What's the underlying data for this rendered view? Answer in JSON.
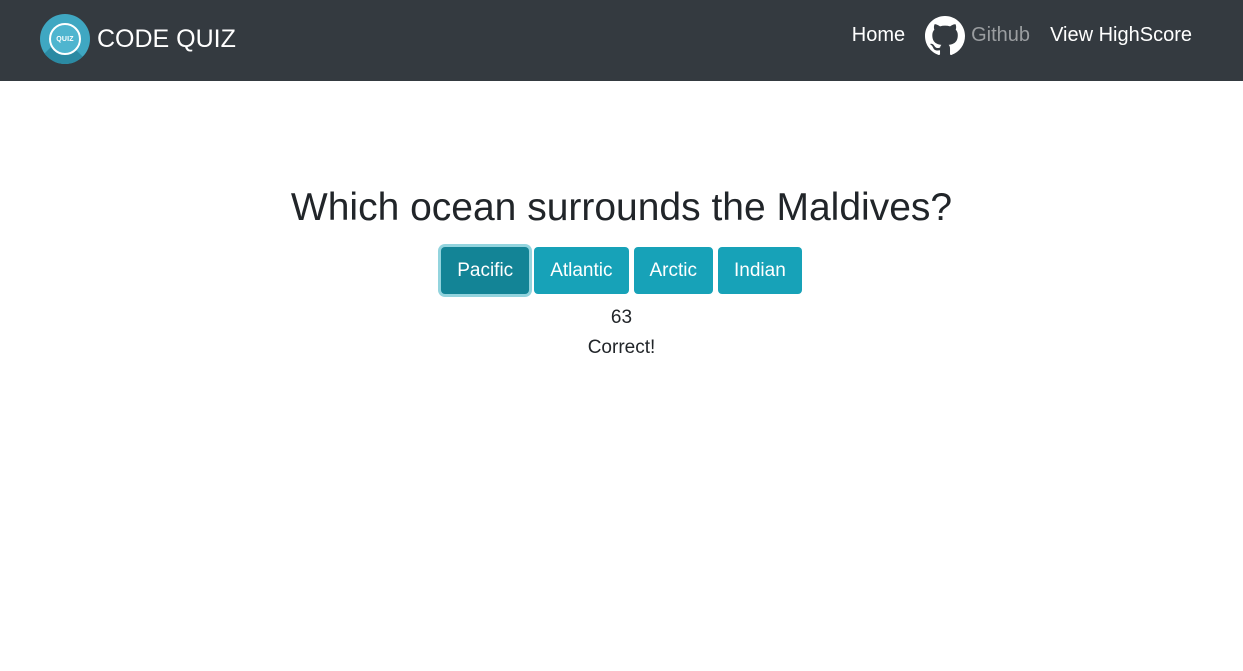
{
  "navbar": {
    "logo_text": "QUIZ",
    "brand_title": "CODE QUIZ",
    "links": {
      "home": "Home",
      "github": "Github",
      "highscore": "View HighScore"
    },
    "icons": {
      "logo": "quiz-logo-icon",
      "github": "github-icon"
    }
  },
  "quiz": {
    "question": "Which ocean surrounds the Maldives?",
    "choices": [
      "Pacific",
      "Atlantic",
      "Arctic",
      "Indian"
    ],
    "selected_choice": "Pacific",
    "score": "63",
    "feedback": "Correct!"
  },
  "colors": {
    "navbar_bg": "#343a40",
    "button_bg": "#17a2b8",
    "button_active_bg": "#138496",
    "logo_bg": "#3fa7c2"
  }
}
